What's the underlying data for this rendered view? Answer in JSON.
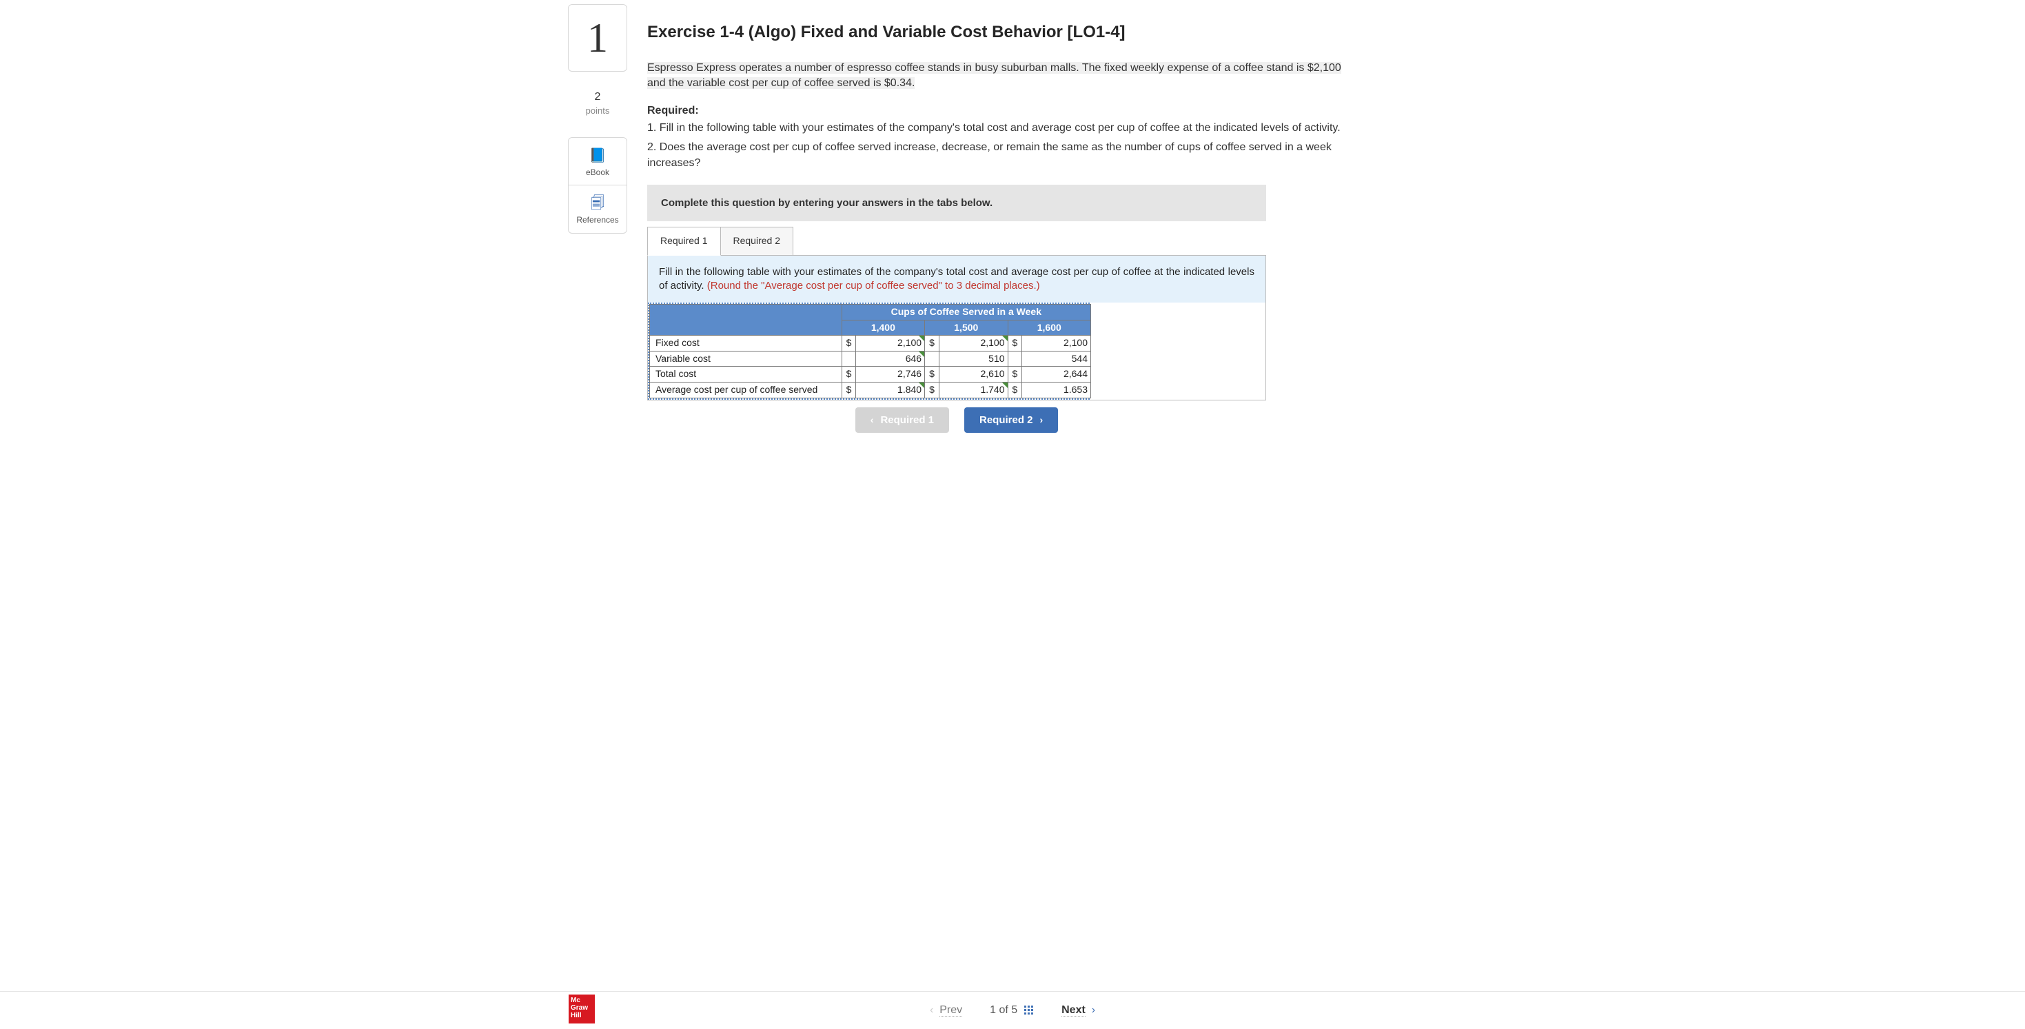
{
  "sidebar": {
    "question_number": "1",
    "points_value": "2",
    "points_label": "points",
    "items": [
      {
        "icon": "📘",
        "label": "eBook",
        "name": "ebook"
      },
      {
        "icon": "🗐",
        "label": "References",
        "name": "references"
      }
    ]
  },
  "header": {
    "title": "Exercise 1-4 (Algo) Fixed and Variable Cost Behavior [LO1-4]"
  },
  "prompt": {
    "scenario": "Espresso Express operates a number of espresso coffee stands in busy suburban malls. The fixed weekly expense of a coffee stand is $2,100 and the variable cost per cup of coffee served is $0.34.",
    "required_header": "Required:",
    "required_1": "1. Fill in the following table with your estimates of the company's total cost and average cost per cup of coffee at the indicated levels of activity.",
    "required_2": "2. Does the average cost per cup of coffee served increase, decrease, or remain the same as the number of cups of coffee served in a week increases?"
  },
  "instruction_bar": "Complete this question by entering your answers in the tabs below.",
  "tabs": [
    {
      "label": "Required 1",
      "active": true
    },
    {
      "label": "Required 2",
      "active": false
    }
  ],
  "tab_body": {
    "text_main": "Fill in the following table with your estimates of the company's total cost and average cost per cup of coffee at the indicated levels of activity. ",
    "text_round": "(Round the \"Average cost per cup of coffee served\" to 3 decimal places.)"
  },
  "table": {
    "super_header": "Cups of Coffee Served in a Week",
    "columns": [
      "1,400",
      "1,500",
      "1,600"
    ],
    "rows": [
      {
        "label": "Fixed cost",
        "cells": [
          {
            "dollar": "$",
            "value": "2,100",
            "corner": true
          },
          {
            "dollar": "$",
            "value": "2,100",
            "corner": true
          },
          {
            "dollar": "$",
            "value": "2,100",
            "corner": false
          }
        ]
      },
      {
        "label": "Variable cost",
        "cells": [
          {
            "dollar": "",
            "value": "646",
            "corner": true
          },
          {
            "dollar": "",
            "value": "510",
            "corner": false
          },
          {
            "dollar": "",
            "value": "544",
            "corner": false
          }
        ]
      },
      {
        "label": "Total cost",
        "cells": [
          {
            "dollar": "$",
            "value": "2,746",
            "corner": false
          },
          {
            "dollar": "$",
            "value": "2,610",
            "corner": false
          },
          {
            "dollar": "$",
            "value": "2,644",
            "corner": false
          }
        ]
      },
      {
        "label": "Average cost per cup of coffee served",
        "cells": [
          {
            "dollar": "$",
            "value": "1.840",
            "corner": true
          },
          {
            "dollar": "$",
            "value": "1.740",
            "corner": true
          },
          {
            "dollar": "$",
            "value": "1.653",
            "corner": false
          }
        ]
      }
    ]
  },
  "nav": {
    "prev": {
      "label": "Required 1",
      "enabled": false
    },
    "next": {
      "label": "Required 2",
      "enabled": true
    }
  },
  "footer": {
    "logo_lines": [
      "Mc",
      "Graw",
      "Hill"
    ],
    "prev": "Prev",
    "position": "1 of 5",
    "next": "Next"
  }
}
